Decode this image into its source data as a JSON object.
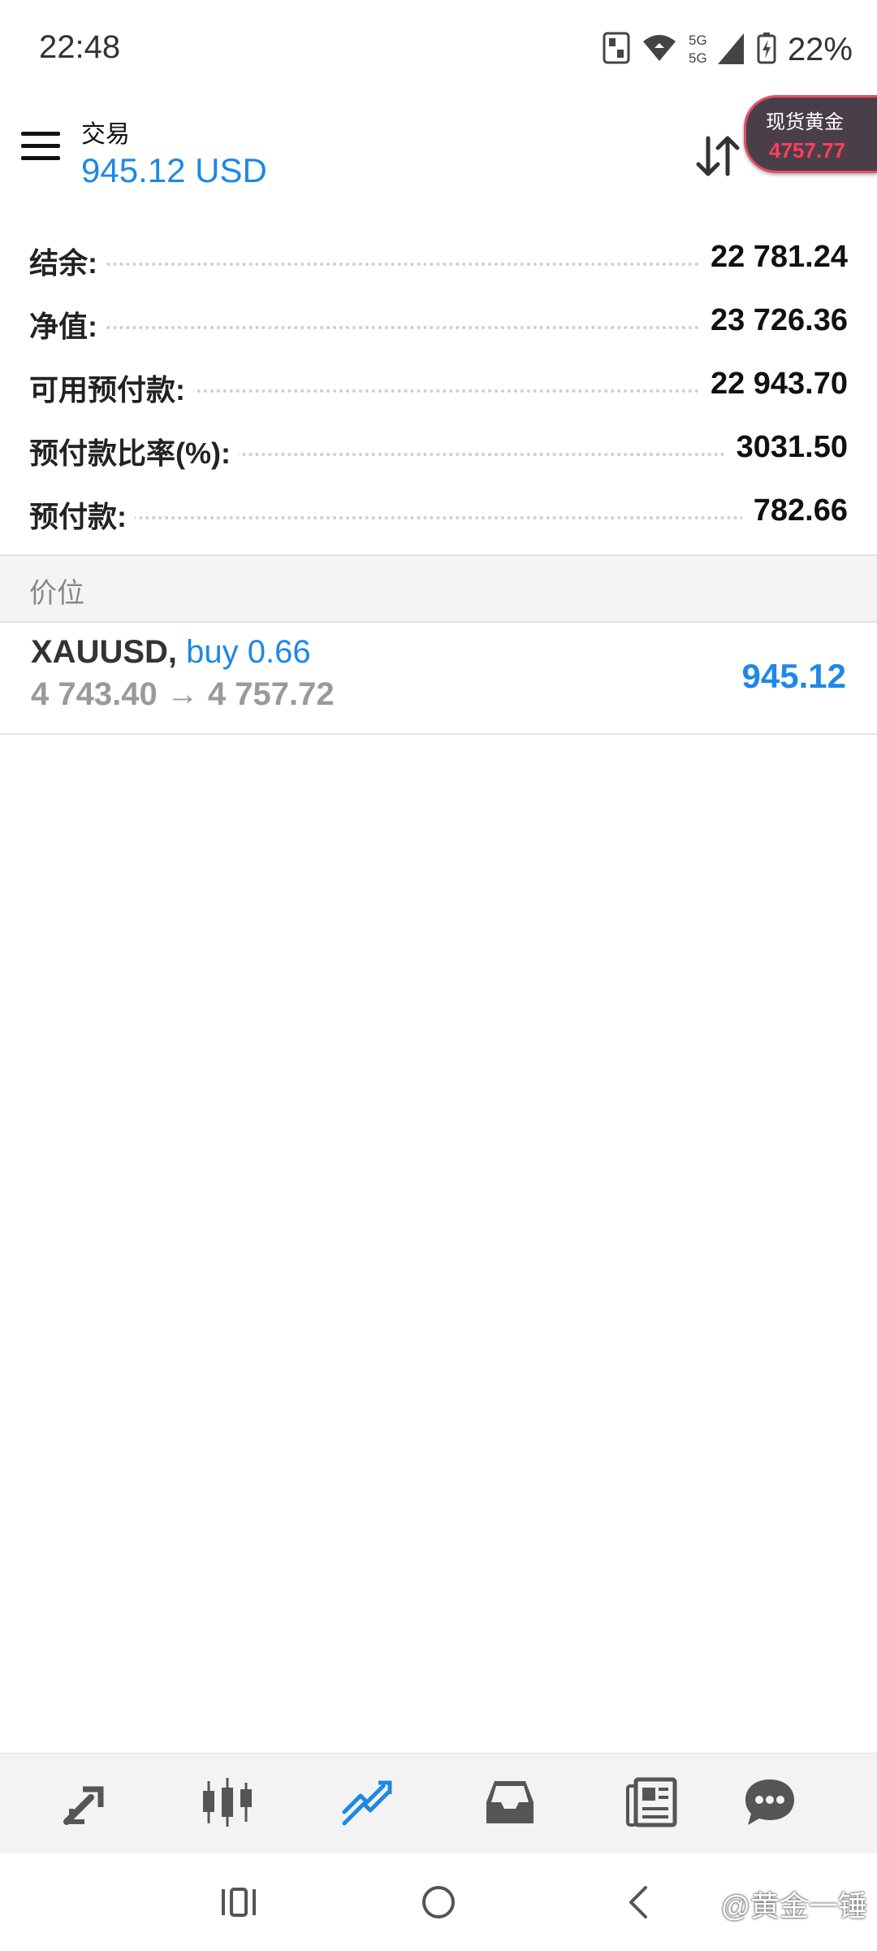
{
  "status_bar": {
    "time": "22:48",
    "battery": "22%",
    "network": "5G",
    "icons": [
      "nfc-icon",
      "wifi-icon",
      "signal-5g-icon",
      "battery-charging-icon"
    ]
  },
  "header": {
    "title": "交易",
    "balance": "945.12 USD",
    "sort_icon": "sort-icon",
    "menu_icon": "hamburger-icon"
  },
  "gold_widget": {
    "label": "现货黄金",
    "price": "4757.77"
  },
  "account": [
    {
      "label": "结余:",
      "value": "22 781.24"
    },
    {
      "label": "净值:",
      "value": "23 726.36"
    },
    {
      "label": "可用预付款:",
      "value": "22 943.70"
    },
    {
      "label": "预付款比率(%):",
      "value": "3031.50"
    },
    {
      "label": "预付款:",
      "value": "782.66"
    }
  ],
  "section": {
    "title": "价位"
  },
  "position": {
    "symbol": "XAUUSD,",
    "side": "buy 0.66",
    "prices": "4 743.40 → 4 757.72",
    "profit": "945.12"
  },
  "tabs": [
    {
      "icon": "quotes-icon",
      "active": false
    },
    {
      "icon": "chart-icon",
      "active": false
    },
    {
      "icon": "trade-icon",
      "active": true
    },
    {
      "icon": "history-icon",
      "active": false
    },
    {
      "icon": "news-icon",
      "active": false
    },
    {
      "icon": "chat-icon",
      "active": false
    }
  ],
  "navbar": {
    "watermark": "@黄金一锤"
  },
  "colors": {
    "accent": "#1e88e5",
    "gold_price": "#ff3e5a",
    "widget_bg": "#4a3f48",
    "inactive_icon": "#555555"
  }
}
